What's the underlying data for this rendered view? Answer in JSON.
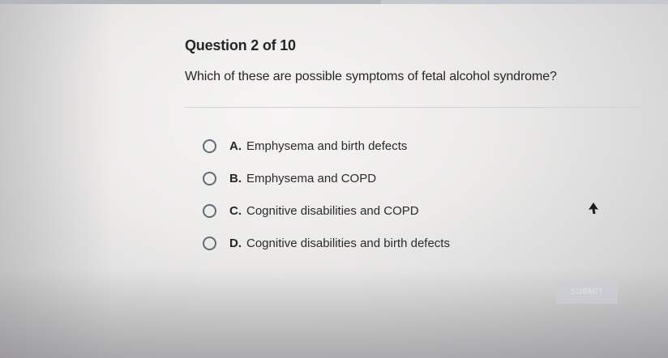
{
  "quiz": {
    "header": "Question 2 of 10",
    "question": "Which of these are possible symptoms of fetal alcohol syndrome?",
    "choices": [
      {
        "letter": "A.",
        "text": "Emphysema and birth defects"
      },
      {
        "letter": "B.",
        "text": "Emphysema and COPD"
      },
      {
        "letter": "C.",
        "text": "Cognitive disabilities and COPD"
      },
      {
        "letter": "D.",
        "text": "Cognitive disabilities and birth defects"
      }
    ],
    "submit_label": "SUBMIT"
  },
  "colors": {
    "text": "#262626",
    "radio_border": "#606b78",
    "divider": "#cfd3d8",
    "submit_disabled_bg": "#ccced4"
  },
  "icons": {
    "cursor": "arrow-cursor-icon",
    "radio": "radio-unchecked-icon"
  }
}
